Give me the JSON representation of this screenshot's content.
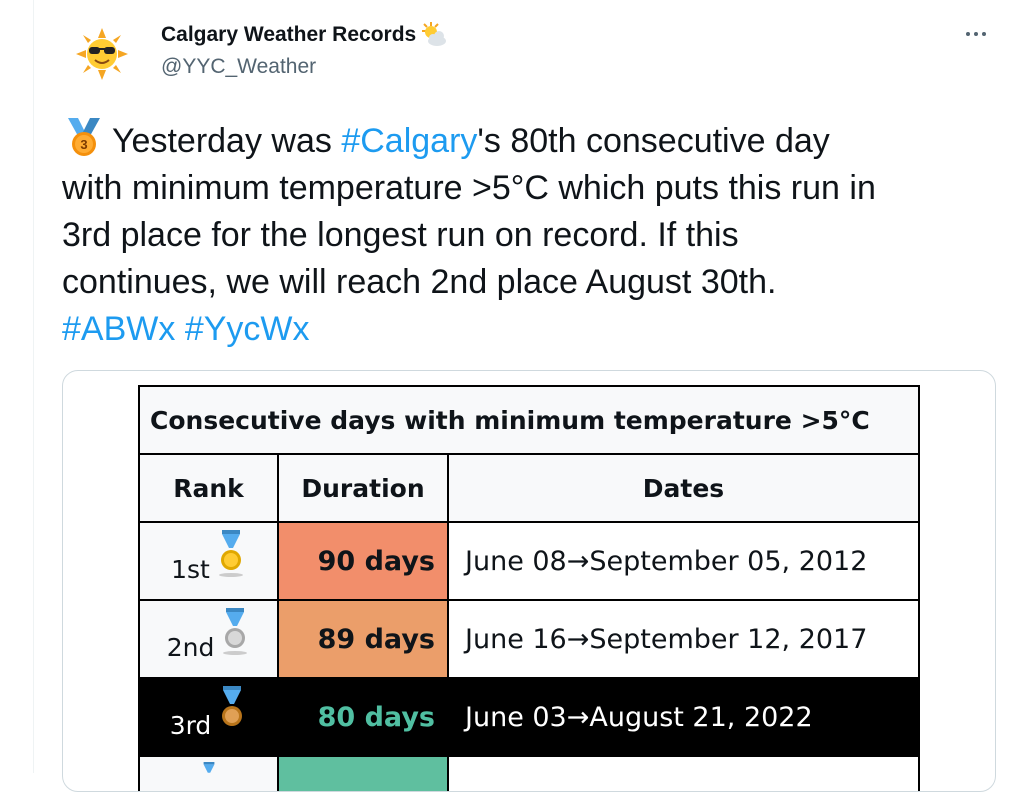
{
  "account": {
    "display_name": "Calgary Weather Records",
    "handle": "@YYC_Weather",
    "avatar_icon": "sunglasses-sun-icon",
    "name_icon": "sun-behind-cloud-icon"
  },
  "tweet": {
    "medal_icon": "third-place-medal-icon",
    "line1_pre": "Yesterday was ",
    "line1_tag": "#Calgary",
    "line1_post": "'s 80th consecutive day",
    "line2": "with minimum temperature >5°C which puts this run in",
    "line3": "3rd place for the longest run on record. If this",
    "line4": "continues, we will reach 2nd place August 30th.",
    "hashtags": [
      "#ABWx",
      "#YycWx"
    ]
  },
  "table": {
    "title": "Consecutive days with minimum temperature >5°C",
    "headers": [
      "Rank",
      "Duration",
      "Dates"
    ],
    "rows": [
      {
        "rank": "1st",
        "medal": "gold-medal-icon",
        "duration": "90 days",
        "dates": "June 08→September 05, 2012",
        "color": "#f28e6b"
      },
      {
        "rank": "2nd",
        "medal": "silver-medal-icon",
        "duration": "89 days",
        "dates": "June 16→September 12, 2017",
        "color": "#eb9e6a"
      },
      {
        "rank": "3rd",
        "medal": "bronze-medal-icon",
        "duration": "80 days",
        "dates": "June 03→August 21, 2022",
        "color": "#000000"
      }
    ],
    "partial_row_color": "#5fbf9f"
  },
  "colors": {
    "hashtag": "#1d9bf0",
    "text": "#0f1419",
    "secondary": "#536471",
    "highlight_text": "#50bfa2"
  }
}
